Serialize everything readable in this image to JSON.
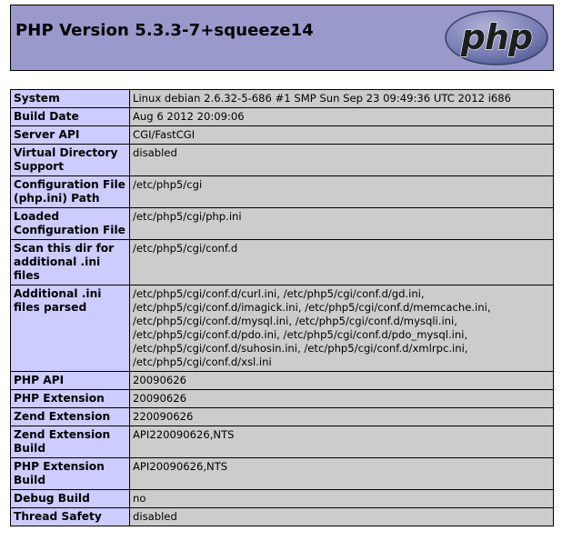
{
  "header": {
    "title": "PHP Version 5.3.3-7+squeeze14",
    "logo_text": "php"
  },
  "colors": {
    "header_bg": "#9999cc",
    "label_bg": "#ccccff",
    "value_bg": "#cccccc"
  },
  "rows": [
    {
      "label": "System",
      "value": "Linux debian 2.6.32-5-686 #1 SMP Sun Sep 23 09:49:36 UTC 2012 i686"
    },
    {
      "label": "Build Date",
      "value": "Aug 6 2012 20:09:06"
    },
    {
      "label": "Server API",
      "value": "CGI/FastCGI"
    },
    {
      "label": "Virtual Directory Support",
      "value": "disabled"
    },
    {
      "label": "Configuration File (php.ini) Path",
      "value": "/etc/php5/cgi"
    },
    {
      "label": "Loaded Configuration File",
      "value": "/etc/php5/cgi/php.ini"
    },
    {
      "label": "Scan this dir for additional .ini files",
      "value": "/etc/php5/cgi/conf.d"
    },
    {
      "label": "Additional .ini files parsed",
      "value": "/etc/php5/cgi/conf.d/curl.ini, /etc/php5/cgi/conf.d/gd.ini, /etc/php5/cgi/conf.d/imagick.ini, /etc/php5/cgi/conf.d/memcache.ini, /etc/php5/cgi/conf.d/mysql.ini, /etc/php5/cgi/conf.d/mysqli.ini, /etc/php5/cgi/conf.d/pdo.ini, /etc/php5/cgi/conf.d/pdo_mysql.ini, /etc/php5/cgi/conf.d/suhosin.ini, /etc/php5/cgi/conf.d/xmlrpc.ini, /etc/php5/cgi/conf.d/xsl.ini"
    },
    {
      "label": "PHP API",
      "value": "20090626"
    },
    {
      "label": "PHP Extension",
      "value": "20090626"
    },
    {
      "label": "Zend Extension",
      "value": "220090626"
    },
    {
      "label": "Zend Extension Build",
      "value": "API220090626,NTS"
    },
    {
      "label": "PHP Extension Build",
      "value": "API20090626,NTS"
    },
    {
      "label": "Debug Build",
      "value": "no"
    },
    {
      "label": "Thread Safety",
      "value": "disabled"
    }
  ]
}
